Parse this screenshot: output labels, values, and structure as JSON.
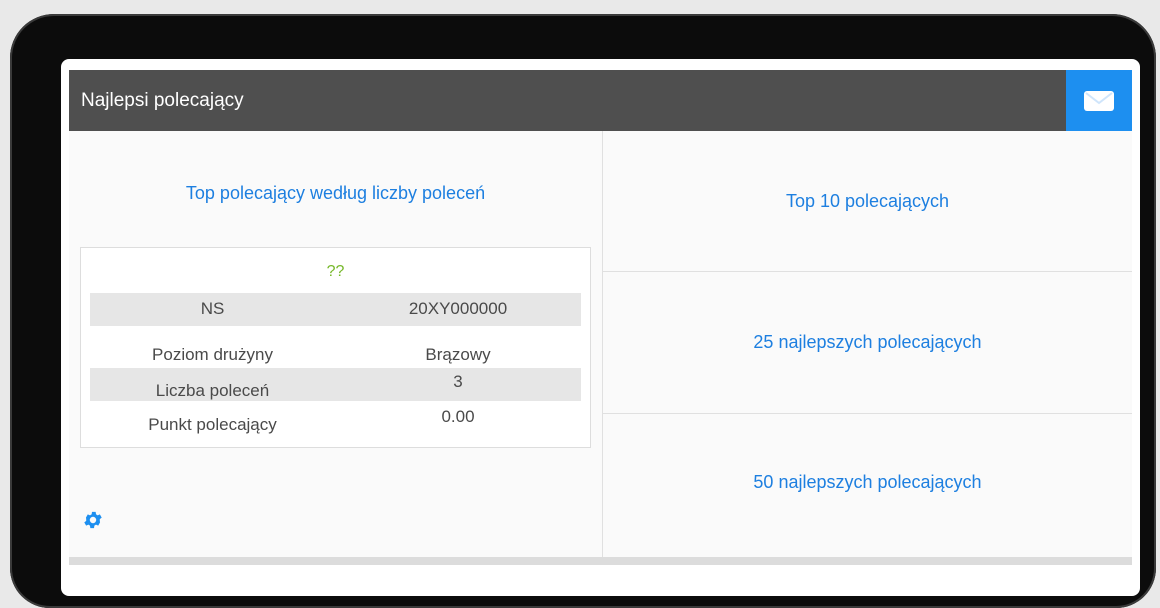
{
  "widget": {
    "title": "Najlepsi polecający",
    "mail_icon": "envelope-icon"
  },
  "left": {
    "title": "Top polecający według liczby poleceń",
    "card": {
      "name": "??",
      "rows": [
        {
          "label": "NS",
          "value": "20XY000000"
        },
        {
          "label": "Poziom drużyny",
          "value": "Brązowy"
        },
        {
          "label": "Liczba poleceń",
          "value": "3"
        },
        {
          "label": "Punkt polecający",
          "value": "0.00"
        }
      ]
    },
    "settings_icon": "gear-icon"
  },
  "right": {
    "items": [
      {
        "label": "Top 10 polecających"
      },
      {
        "label": "25 najlepszych polecających"
      },
      {
        "label": "50 najlepszych polecających"
      }
    ]
  },
  "colors": {
    "accent": "#1d8ff0",
    "header_bg": "#4f4f4f",
    "link": "#1d7fe0",
    "name_green": "#76b82a"
  }
}
